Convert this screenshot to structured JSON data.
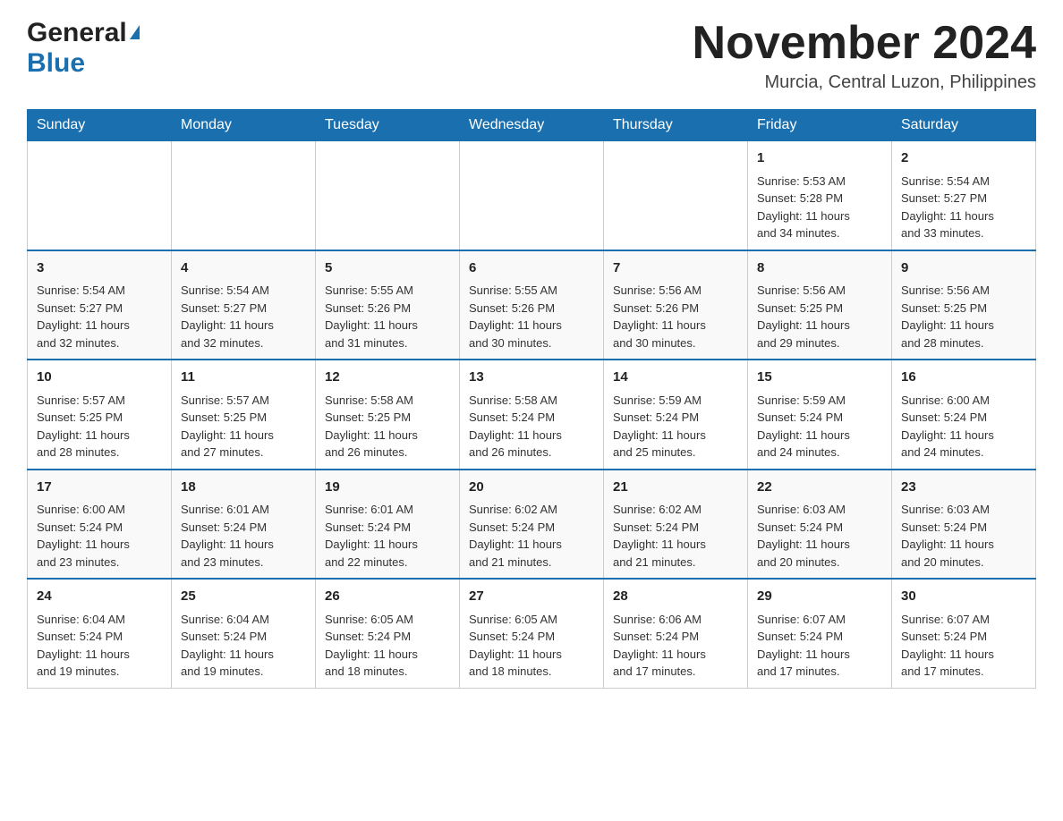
{
  "header": {
    "logo_general": "General",
    "logo_blue": "Blue",
    "month_title": "November 2024",
    "location": "Murcia, Central Luzon, Philippines"
  },
  "days_of_week": [
    "Sunday",
    "Monday",
    "Tuesday",
    "Wednesday",
    "Thursday",
    "Friday",
    "Saturday"
  ],
  "weeks": [
    [
      {
        "day": "",
        "info": ""
      },
      {
        "day": "",
        "info": ""
      },
      {
        "day": "",
        "info": ""
      },
      {
        "day": "",
        "info": ""
      },
      {
        "day": "",
        "info": ""
      },
      {
        "day": "1",
        "info": "Sunrise: 5:53 AM\nSunset: 5:28 PM\nDaylight: 11 hours\nand 34 minutes."
      },
      {
        "day": "2",
        "info": "Sunrise: 5:54 AM\nSunset: 5:27 PM\nDaylight: 11 hours\nand 33 minutes."
      }
    ],
    [
      {
        "day": "3",
        "info": "Sunrise: 5:54 AM\nSunset: 5:27 PM\nDaylight: 11 hours\nand 32 minutes."
      },
      {
        "day": "4",
        "info": "Sunrise: 5:54 AM\nSunset: 5:27 PM\nDaylight: 11 hours\nand 32 minutes."
      },
      {
        "day": "5",
        "info": "Sunrise: 5:55 AM\nSunset: 5:26 PM\nDaylight: 11 hours\nand 31 minutes."
      },
      {
        "day": "6",
        "info": "Sunrise: 5:55 AM\nSunset: 5:26 PM\nDaylight: 11 hours\nand 30 minutes."
      },
      {
        "day": "7",
        "info": "Sunrise: 5:56 AM\nSunset: 5:26 PM\nDaylight: 11 hours\nand 30 minutes."
      },
      {
        "day": "8",
        "info": "Sunrise: 5:56 AM\nSunset: 5:25 PM\nDaylight: 11 hours\nand 29 minutes."
      },
      {
        "day": "9",
        "info": "Sunrise: 5:56 AM\nSunset: 5:25 PM\nDaylight: 11 hours\nand 28 minutes."
      }
    ],
    [
      {
        "day": "10",
        "info": "Sunrise: 5:57 AM\nSunset: 5:25 PM\nDaylight: 11 hours\nand 28 minutes."
      },
      {
        "day": "11",
        "info": "Sunrise: 5:57 AM\nSunset: 5:25 PM\nDaylight: 11 hours\nand 27 minutes."
      },
      {
        "day": "12",
        "info": "Sunrise: 5:58 AM\nSunset: 5:25 PM\nDaylight: 11 hours\nand 26 minutes."
      },
      {
        "day": "13",
        "info": "Sunrise: 5:58 AM\nSunset: 5:24 PM\nDaylight: 11 hours\nand 26 minutes."
      },
      {
        "day": "14",
        "info": "Sunrise: 5:59 AM\nSunset: 5:24 PM\nDaylight: 11 hours\nand 25 minutes."
      },
      {
        "day": "15",
        "info": "Sunrise: 5:59 AM\nSunset: 5:24 PM\nDaylight: 11 hours\nand 24 minutes."
      },
      {
        "day": "16",
        "info": "Sunrise: 6:00 AM\nSunset: 5:24 PM\nDaylight: 11 hours\nand 24 minutes."
      }
    ],
    [
      {
        "day": "17",
        "info": "Sunrise: 6:00 AM\nSunset: 5:24 PM\nDaylight: 11 hours\nand 23 minutes."
      },
      {
        "day": "18",
        "info": "Sunrise: 6:01 AM\nSunset: 5:24 PM\nDaylight: 11 hours\nand 23 minutes."
      },
      {
        "day": "19",
        "info": "Sunrise: 6:01 AM\nSunset: 5:24 PM\nDaylight: 11 hours\nand 22 minutes."
      },
      {
        "day": "20",
        "info": "Sunrise: 6:02 AM\nSunset: 5:24 PM\nDaylight: 11 hours\nand 21 minutes."
      },
      {
        "day": "21",
        "info": "Sunrise: 6:02 AM\nSunset: 5:24 PM\nDaylight: 11 hours\nand 21 minutes."
      },
      {
        "day": "22",
        "info": "Sunrise: 6:03 AM\nSunset: 5:24 PM\nDaylight: 11 hours\nand 20 minutes."
      },
      {
        "day": "23",
        "info": "Sunrise: 6:03 AM\nSunset: 5:24 PM\nDaylight: 11 hours\nand 20 minutes."
      }
    ],
    [
      {
        "day": "24",
        "info": "Sunrise: 6:04 AM\nSunset: 5:24 PM\nDaylight: 11 hours\nand 19 minutes."
      },
      {
        "day": "25",
        "info": "Sunrise: 6:04 AM\nSunset: 5:24 PM\nDaylight: 11 hours\nand 19 minutes."
      },
      {
        "day": "26",
        "info": "Sunrise: 6:05 AM\nSunset: 5:24 PM\nDaylight: 11 hours\nand 18 minutes."
      },
      {
        "day": "27",
        "info": "Sunrise: 6:05 AM\nSunset: 5:24 PM\nDaylight: 11 hours\nand 18 minutes."
      },
      {
        "day": "28",
        "info": "Sunrise: 6:06 AM\nSunset: 5:24 PM\nDaylight: 11 hours\nand 17 minutes."
      },
      {
        "day": "29",
        "info": "Sunrise: 6:07 AM\nSunset: 5:24 PM\nDaylight: 11 hours\nand 17 minutes."
      },
      {
        "day": "30",
        "info": "Sunrise: 6:07 AM\nSunset: 5:24 PM\nDaylight: 11 hours\nand 17 minutes."
      }
    ]
  ]
}
